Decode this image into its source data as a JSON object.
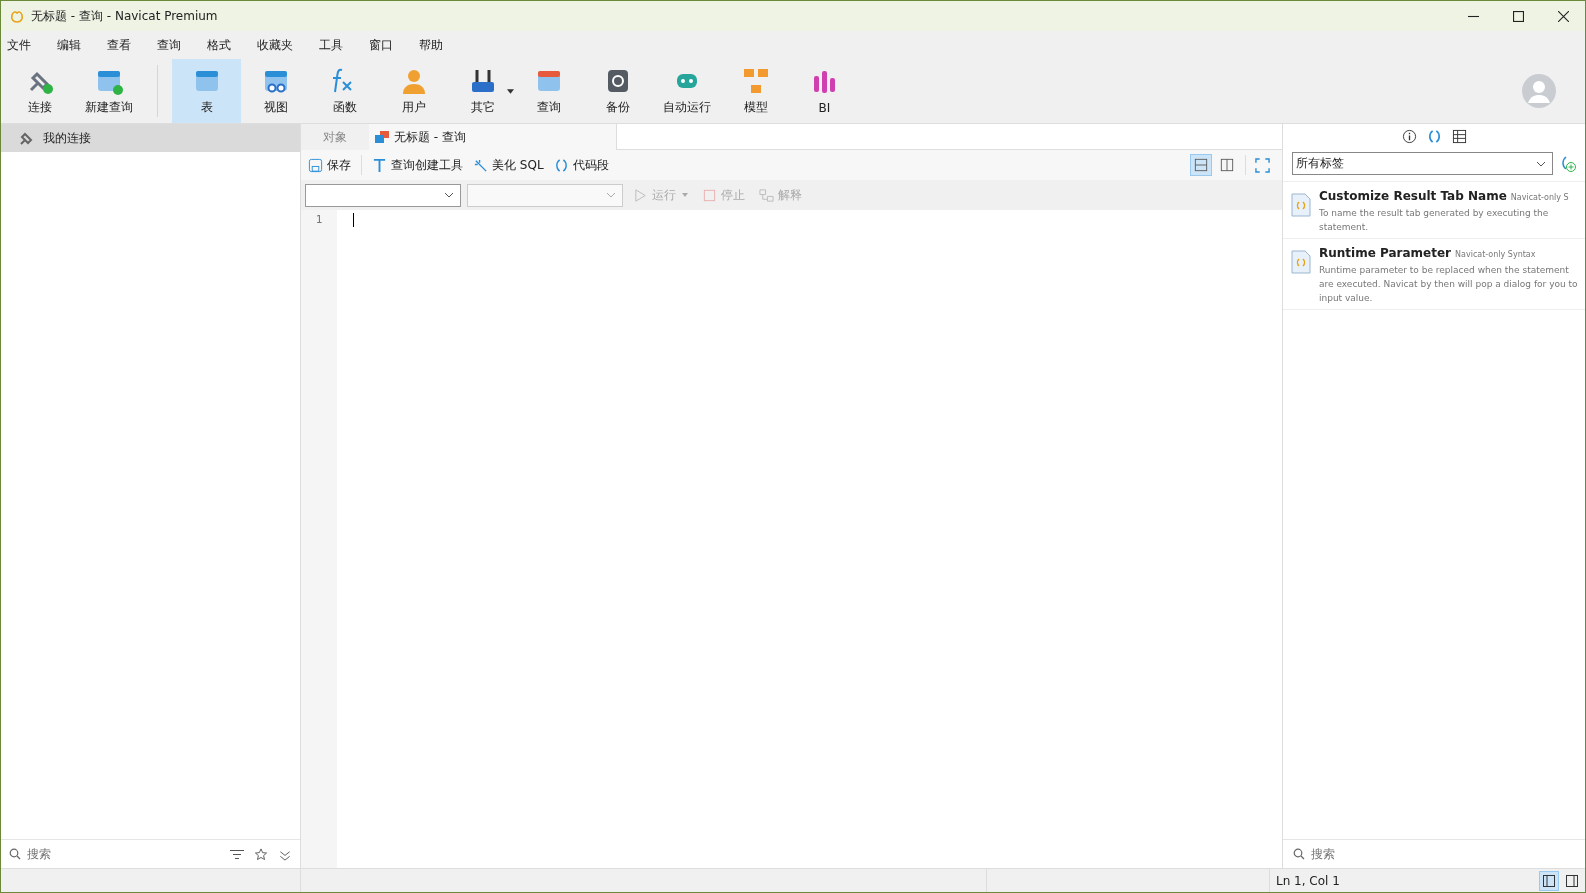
{
  "window": {
    "title": "无标题 - 查询 - Navicat Premium"
  },
  "menu": [
    "文件",
    "编辑",
    "查看",
    "查询",
    "格式",
    "收藏夹",
    "工具",
    "窗口",
    "帮助"
  ],
  "toolbar": [
    {
      "label": "连接",
      "kind": "connect",
      "selected": false
    },
    {
      "label": "新建查询",
      "kind": "newquery",
      "selected": false
    },
    {
      "label": "表",
      "kind": "table",
      "selected": true
    },
    {
      "label": "视图",
      "kind": "view",
      "selected": false
    },
    {
      "label": "函数",
      "kind": "function",
      "selected": false
    },
    {
      "label": "用户",
      "kind": "user",
      "selected": false
    },
    {
      "label": "其它",
      "kind": "other",
      "selected": false
    },
    {
      "label": "查询",
      "kind": "query",
      "selected": false
    },
    {
      "label": "备份",
      "kind": "backup",
      "selected": false
    },
    {
      "label": "自动运行",
      "kind": "robot",
      "selected": false
    },
    {
      "label": "模型",
      "kind": "model",
      "selected": false
    },
    {
      "label": "BI",
      "kind": "bi",
      "selected": false
    }
  ],
  "sidebar": {
    "items": [
      {
        "label": "我的连接",
        "selected": true
      }
    ],
    "search": {
      "placeholder": "搜索"
    }
  },
  "tabs": [
    {
      "label": "对象",
      "selected": false
    },
    {
      "label": "无标题 - 查询",
      "selected": true
    }
  ],
  "editor_toolbar": {
    "buttons": [
      {
        "label": "保存",
        "kind": "save"
      },
      {
        "label": "查询创建工具",
        "kind": "builder"
      },
      {
        "label": "美化 SQL",
        "kind": "beautify"
      },
      {
        "label": "代码段",
        "kind": "snippet"
      }
    ],
    "layouts": [
      {
        "kind": "stacked",
        "selected": true
      },
      {
        "kind": "side",
        "selected": false
      }
    ]
  },
  "run_bar": [
    {
      "label": "运行",
      "disabled": true,
      "kind": "run"
    },
    {
      "label": "停止",
      "disabled": true,
      "kind": "stop"
    },
    {
      "label": "解释",
      "disabled": true,
      "kind": "explain"
    }
  ],
  "editor": {
    "line_numbers": [
      "1"
    ]
  },
  "snippets_panel": {
    "filter": "所有标签",
    "items": [
      {
        "title": "Customize Result Tab Name",
        "tag": "Navicat-only S",
        "description": "To name the result tab generated by executing the statement."
      },
      {
        "title": "Runtime Parameter",
        "tag": "Navicat-only Syntax",
        "description": "Runtime parameter to be replaced when the statement are executed. Navicat by then will pop a dialog for you to input value."
      }
    ],
    "search": {
      "placeholder": "搜索"
    }
  },
  "status_bar": {
    "position": "Ln 1, Col 1"
  }
}
